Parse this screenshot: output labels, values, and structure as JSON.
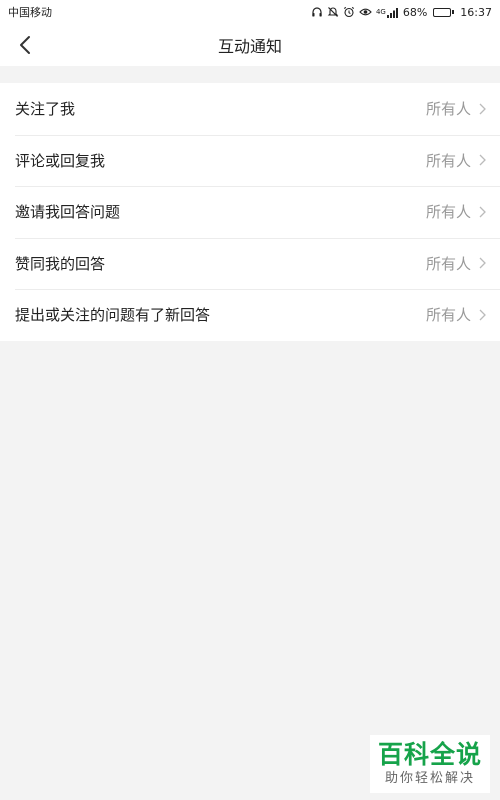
{
  "status_bar": {
    "carrier": "中国移动",
    "network": "4G",
    "battery_percent": "68%",
    "battery_level": 0.68,
    "time": "16:37",
    "icons": [
      "headphones-icon",
      "mute-icon",
      "alarm-icon",
      "eye-icon",
      "signal-icon",
      "battery-icon"
    ]
  },
  "nav": {
    "title": "互动通知",
    "back_icon": "back-arrow-icon"
  },
  "settings": [
    {
      "label": "关注了我",
      "value": "所有人"
    },
    {
      "label": "评论或回复我",
      "value": "所有人"
    },
    {
      "label": "邀请我回答问题",
      "value": "所有人"
    },
    {
      "label": "赞同我的回答",
      "value": "所有人"
    },
    {
      "label": "提出或关注的问题有了新回答",
      "value": "所有人"
    }
  ],
  "watermark": {
    "title": "百科全说",
    "subtitle": "助你轻松解决"
  },
  "colors": {
    "background": "#f3f3f3",
    "surface": "#ffffff",
    "value_text": "#999999",
    "battery": "#2bb24c",
    "watermark_green": "#16a34a"
  }
}
